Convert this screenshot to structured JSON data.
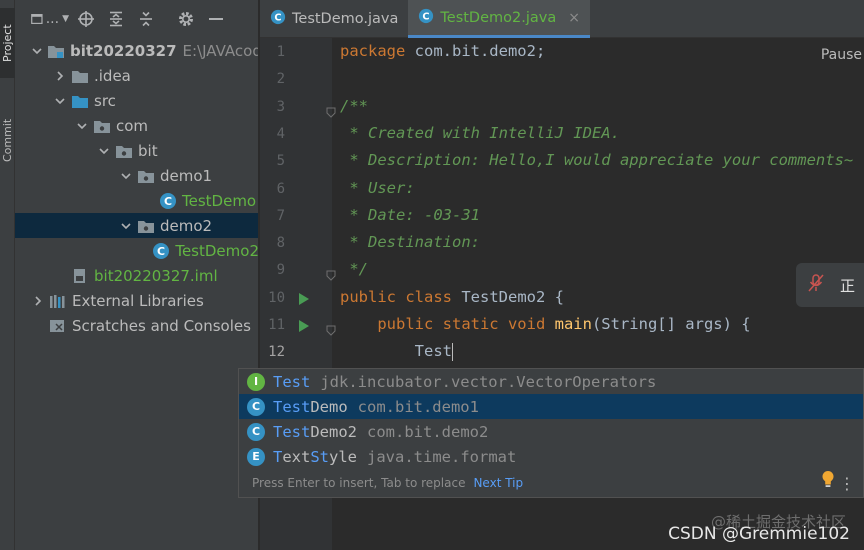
{
  "side_tabs": {
    "project": "Project",
    "commit": "Commit"
  },
  "project_panel": {
    "view_label": "...",
    "tree": [
      {
        "label": "bit20220327",
        "path": "E:\\JAVAcode\\g",
        "kind": "module",
        "expanded": true,
        "depth": 0
      },
      {
        "label": ".idea",
        "kind": "folder",
        "expanded": false,
        "depth": 1
      },
      {
        "label": "src",
        "kind": "source-folder",
        "expanded": true,
        "depth": 1
      },
      {
        "label": "com",
        "kind": "package",
        "expanded": true,
        "depth": 2
      },
      {
        "label": "bit",
        "kind": "package",
        "expanded": true,
        "depth": 3
      },
      {
        "label": "demo1",
        "kind": "package",
        "expanded": true,
        "depth": 4
      },
      {
        "label": "TestDemo",
        "kind": "class",
        "depth": 5
      },
      {
        "label": "demo2",
        "kind": "package",
        "expanded": true,
        "depth": 4,
        "selected": true
      },
      {
        "label": "TestDemo2",
        "kind": "class",
        "depth": 5
      },
      {
        "label": "bit20220327.iml",
        "kind": "iml",
        "depth": 1
      },
      {
        "label": "External Libraries",
        "kind": "libraries",
        "expanded": false,
        "depth": 0
      },
      {
        "label": "Scratches and Consoles",
        "kind": "scratches",
        "depth": 0
      }
    ]
  },
  "editor_tabs": [
    {
      "label": "TestDemo.java",
      "active": false
    },
    {
      "label": "TestDemo2.java",
      "active": true,
      "close": "×"
    }
  ],
  "code_lines": [
    {
      "n": "1",
      "segs": [
        [
          "kw",
          "package "
        ],
        [
          "",
          "com.bit.demo2;"
        ]
      ]
    },
    {
      "n": "2",
      "segs": []
    },
    {
      "n": "3",
      "segs": [
        [
          "doc",
          "/**"
        ]
      ]
    },
    {
      "n": "4",
      "segs": [
        [
          "doc",
          " * Created with IntelliJ IDEA."
        ]
      ]
    },
    {
      "n": "5",
      "segs": [
        [
          "doc",
          " * Description: Hello,I would appreciate your comments~"
        ]
      ]
    },
    {
      "n": "6",
      "segs": [
        [
          "doc",
          " * User:"
        ]
      ]
    },
    {
      "n": "7",
      "segs": [
        [
          "doc",
          " * Date: -03-31"
        ]
      ]
    },
    {
      "n": "8",
      "segs": [
        [
          "doc",
          " * Destination:"
        ]
      ]
    },
    {
      "n": "9",
      "segs": [
        [
          "doc",
          " */"
        ]
      ]
    },
    {
      "n": "10",
      "segs": [
        [
          "kw",
          "public class "
        ],
        [
          "",
          "TestDemo2 {"
        ]
      ],
      "run": true
    },
    {
      "n": "11",
      "segs": [
        [
          "",
          "    "
        ],
        [
          "kw",
          "public static void "
        ],
        [
          "fn",
          "main"
        ],
        [
          "",
          "(String[] args) {"
        ]
      ],
      "run": true,
      "fold": true
    },
    {
      "n": "12",
      "segs": [
        [
          "",
          "        Test"
        ]
      ],
      "caret": true,
      "current": true
    }
  ],
  "editor_status": {
    "pause": "Pause"
  },
  "floating_widget": {
    "text": "正"
  },
  "completion": {
    "items": [
      {
        "icon_letter": "I",
        "icon_color": "#62b543",
        "match": "Test",
        "rest": "",
        "pkg": "jdk.incubator.vector.VectorOperators"
      },
      {
        "icon_letter": "C",
        "icon_color": "#3592c4",
        "match": "Test",
        "rest": "Demo",
        "pkg": "com.bit.demo1",
        "selected": true
      },
      {
        "icon_letter": "C",
        "icon_color": "#3592c4",
        "match": "Test",
        "rest": "Demo2",
        "pkg": "com.bit.demo2"
      },
      {
        "icon_letter": "E",
        "icon_color": "#3592c4",
        "match": "T",
        "mid": "ext",
        "match2": "St",
        "rest": "yle",
        "pkg": "java.time.format"
      }
    ],
    "footer": "Press Enter to insert, Tab to replace",
    "footer_link": "Next Tip",
    "menu": "⋮"
  },
  "watermark": {
    "line1": "@稀土掘金技术社区",
    "line2": "CSDN @Gremmie102"
  },
  "colors": {
    "keyword": "#cc7832",
    "doc": "#629755",
    "method": "#ffc66d",
    "match": "#589df6",
    "green": "#62b543",
    "selection": "#0d293e"
  }
}
